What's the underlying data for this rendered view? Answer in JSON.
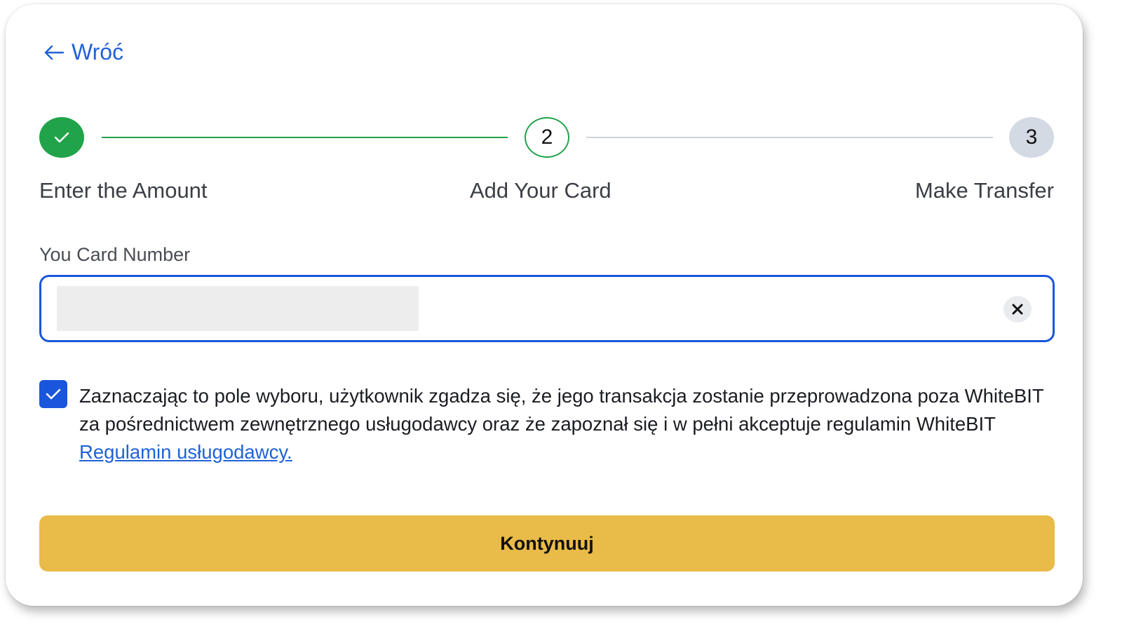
{
  "back": {
    "label": "Wróć"
  },
  "stepper": {
    "steps": [
      {
        "number": "1",
        "label": "Enter the Amount",
        "status": "completed"
      },
      {
        "number": "2",
        "label": "Add Your Card",
        "status": "active"
      },
      {
        "number": "3",
        "label": "Make Transfer",
        "status": "pending"
      }
    ]
  },
  "card_field": {
    "label": "You Card Number",
    "value": ""
  },
  "consent": {
    "checked": true,
    "text": "Zaznaczając to pole wyboru, użytkownik zgadza się, że jego transakcja zostanie przeprowadzona poza WhiteBIT za pośrednictwem zewnętrznego usługodawcy oraz że zapoznał się i w pełni akceptuje regulamin WhiteBIT ",
    "link_text": "Regulamin usługodawcy."
  },
  "actions": {
    "continue_label": "Kontynuuj"
  },
  "colors": {
    "accent": "#1a56db",
    "success": "#21a34a",
    "button": "#e9bb48",
    "link": "#1f62d8"
  }
}
